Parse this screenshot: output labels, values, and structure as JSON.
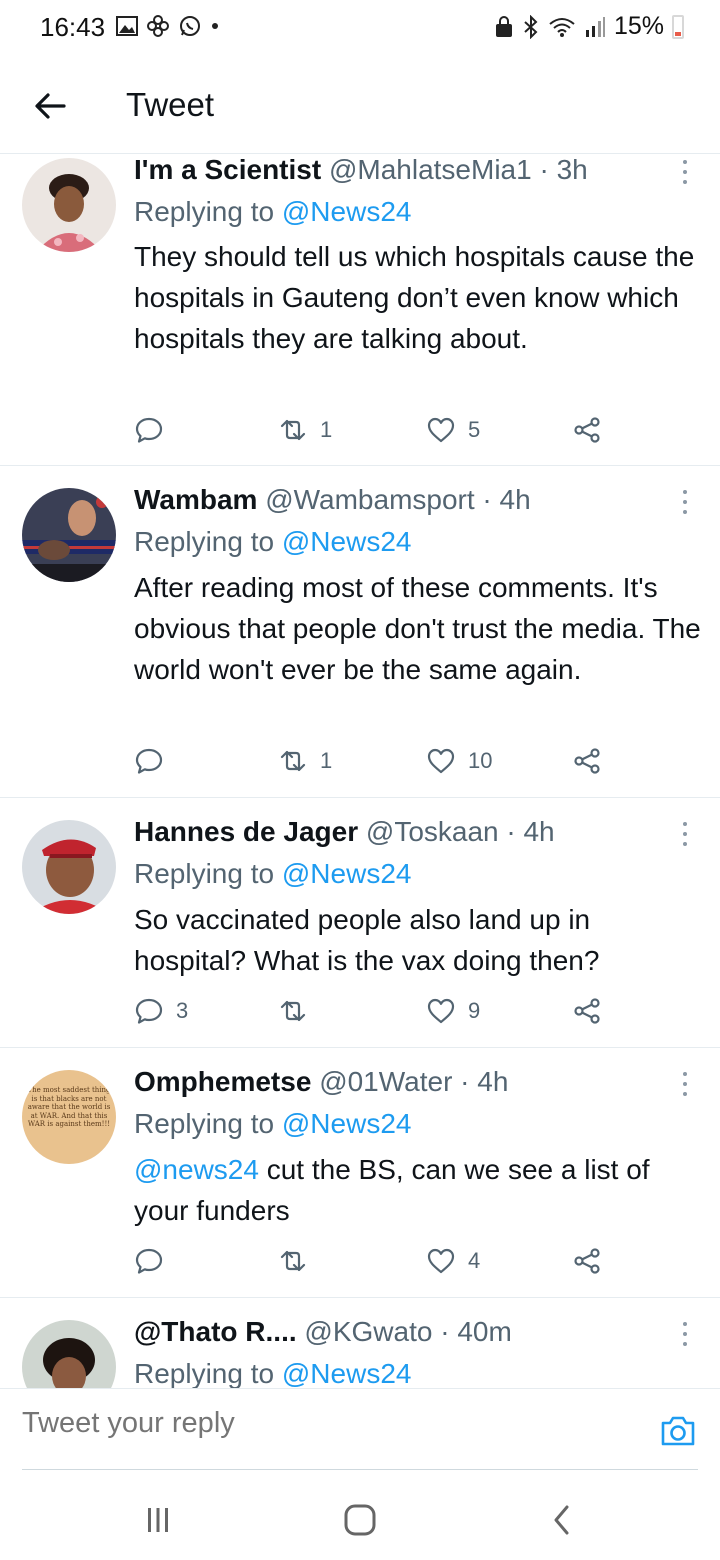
{
  "status_bar": {
    "time": "16:43",
    "battery": "15%",
    "left_icons": [
      "gallery-icon",
      "pinwheel-icon",
      "whatsapp-icon",
      "dot-icon"
    ],
    "right_icons": [
      "lock-icon",
      "bluetooth-icon",
      "wifi-icon",
      "signal-icon",
      "battery-icon"
    ]
  },
  "header": {
    "title": "Tweet"
  },
  "colors": {
    "link": "#1d9bf0",
    "secondary_text": "#536471",
    "divider": "#e6ecf0",
    "battery_low": "#e85c4a"
  },
  "tweets": [
    {
      "name": "I'm a Scientist",
      "meta": "@MahlatseMia1 · 3h",
      "replying_prefix": "Replying to ",
      "replying_to": "@News24",
      "text": "They should tell us which hospitals cause the hospitals in Gauteng don’t even know which hospitals they are talking about.",
      "replies": "",
      "retweets": "1",
      "likes": "5"
    },
    {
      "name": "Wambam",
      "meta": "@Wambamsport · 4h",
      "replying_prefix": "Replying to ",
      "replying_to": "@News24",
      "text": "After reading most of these comments. It's obvious that people don't trust the media. The world won't ever be the same again.",
      "replies": "",
      "retweets": "1",
      "likes": "10"
    },
    {
      "name": "Hannes de Jager",
      "meta": "@Toskaan · 4h",
      "replying_prefix": "Replying to ",
      "replying_to": "@News24",
      "text": "So vaccinated people also land up in hospital? What is the vax doing then?",
      "replies": "3",
      "retweets": "",
      "likes": "9"
    },
    {
      "name": "Omphemetse",
      "meta": "@01Water · 4h",
      "replying_prefix": "Replying to ",
      "replying_to": "@News24",
      "mention": "@news24",
      "text": " cut the BS, can we see a list of your funders",
      "replies": "",
      "retweets": "",
      "likes": "4",
      "avatar_text": "The most saddest thing is that blacks are not aware that the world is at WAR. And that this WAR is against them!!!"
    },
    {
      "name": "@Thato R....",
      "meta": "@KGwato · 40m",
      "replying_prefix": "Replying to ",
      "replying_to": "@News24"
    }
  ],
  "composer": {
    "placeholder": "Tweet your reply"
  },
  "nav": {
    "icons": [
      "recent-apps-icon",
      "home-icon",
      "back-icon"
    ]
  }
}
